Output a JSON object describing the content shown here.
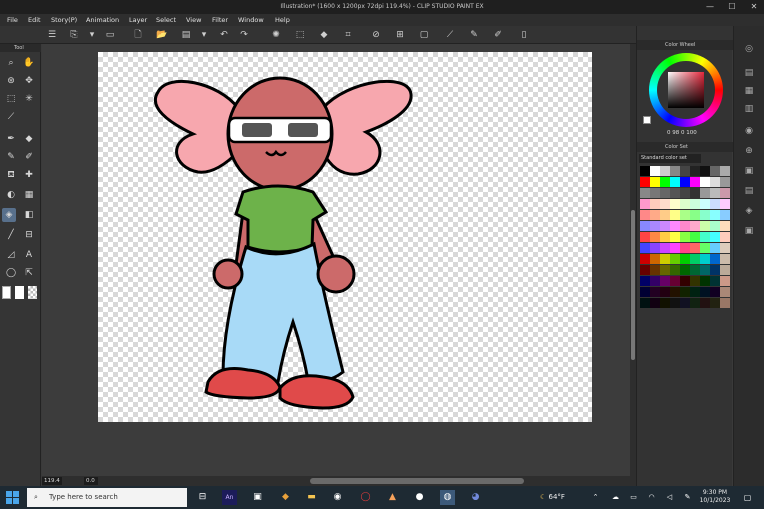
{
  "window": {
    "title": "Illustration* (1600 x 1200px 72dpi 119.4%) - CLIP STUDIO PAINT EX",
    "min": "—",
    "max": "☐",
    "close": "✕"
  },
  "menu": [
    "File",
    "Edit",
    "Story(P)",
    "Animation",
    "Layer",
    "Select",
    "View",
    "Filter",
    "Window",
    "Help"
  ],
  "tool_panel": {
    "tab_label": "Tool"
  },
  "bottom_bar": {
    "zoom": "119.4",
    "angle": "0.0"
  },
  "color_panel": {
    "wheel_tab": "Color Wheel",
    "set_tab": "Color Set",
    "set_name": "Standard color set",
    "values": "0 98 0 100",
    "accent": "#e6283c"
  },
  "taskbar": {
    "search_placeholder": "Type here to search",
    "temperature": "64°F",
    "time": "9:30 PM",
    "date": "10/1/2023"
  }
}
